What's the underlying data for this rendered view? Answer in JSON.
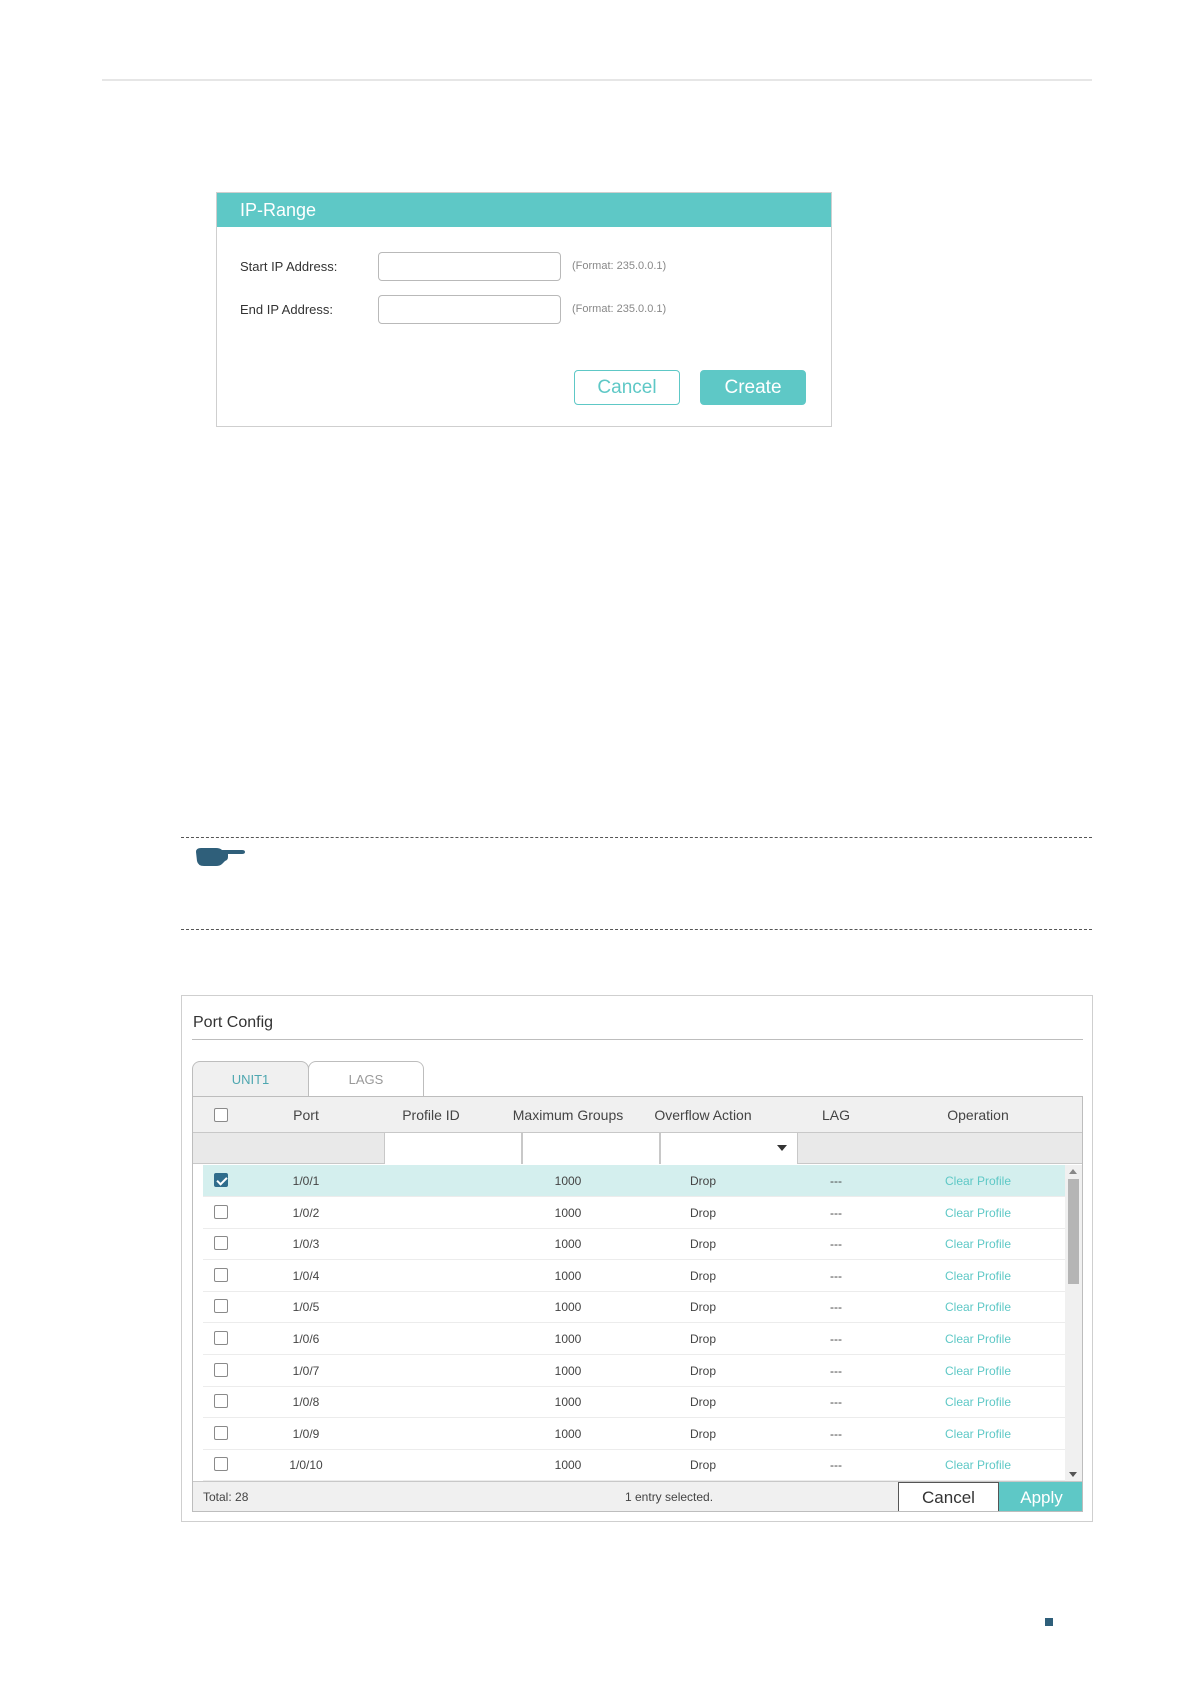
{
  "ip_range": {
    "title": "IP-Range",
    "start_label": "Start IP Address:",
    "start_value": "",
    "start_hint": "(Format: 235.0.0.1)",
    "end_label": "End IP Address:",
    "end_value": "",
    "end_hint": "(Format: 235.0.0.1)",
    "cancel_label": "Cancel",
    "create_label": "Create"
  },
  "port_config": {
    "title": "Port Config",
    "tabs": [
      {
        "label": "UNIT1",
        "active": true
      },
      {
        "label": "LAGS",
        "active": false
      }
    ],
    "columns": [
      "Port",
      "Profile ID",
      "Maximum Groups",
      "Overflow Action",
      "LAG",
      "Operation"
    ],
    "rows": [
      {
        "checked": true,
        "port": "1/0/1",
        "profile_id": "",
        "max_groups": "1000",
        "overflow": "Drop",
        "lag": "---",
        "op": "Clear Profile"
      },
      {
        "checked": false,
        "port": "1/0/2",
        "profile_id": "",
        "max_groups": "1000",
        "overflow": "Drop",
        "lag": "---",
        "op": "Clear Profile"
      },
      {
        "checked": false,
        "port": "1/0/3",
        "profile_id": "",
        "max_groups": "1000",
        "overflow": "Drop",
        "lag": "---",
        "op": "Clear Profile"
      },
      {
        "checked": false,
        "port": "1/0/4",
        "profile_id": "",
        "max_groups": "1000",
        "overflow": "Drop",
        "lag": "---",
        "op": "Clear Profile"
      },
      {
        "checked": false,
        "port": "1/0/5",
        "profile_id": "",
        "max_groups": "1000",
        "overflow": "Drop",
        "lag": "---",
        "op": "Clear Profile"
      },
      {
        "checked": false,
        "port": "1/0/6",
        "profile_id": "",
        "max_groups": "1000",
        "overflow": "Drop",
        "lag": "---",
        "op": "Clear Profile"
      },
      {
        "checked": false,
        "port": "1/0/7",
        "profile_id": "",
        "max_groups": "1000",
        "overflow": "Drop",
        "lag": "---",
        "op": "Clear Profile"
      },
      {
        "checked": false,
        "port": "1/0/8",
        "profile_id": "",
        "max_groups": "1000",
        "overflow": "Drop",
        "lag": "---",
        "op": "Clear Profile"
      },
      {
        "checked": false,
        "port": "1/0/9",
        "profile_id": "",
        "max_groups": "1000",
        "overflow": "Drop",
        "lag": "---",
        "op": "Clear Profile"
      },
      {
        "checked": false,
        "port": "1/0/10",
        "profile_id": "",
        "max_groups": "1000",
        "overflow": "Drop",
        "lag": "---",
        "op": "Clear Profile"
      }
    ],
    "footer": {
      "total": "Total: 28",
      "selected": "1 entry selected.",
      "cancel_label": "Cancel",
      "apply_label": "Apply"
    }
  },
  "icons": {
    "note": "pointing-hand-icon"
  },
  "colors": {
    "accent": "#5ec8c6",
    "selected_row": "#d4efee",
    "checkbox_checked": "#2f6d8c"
  }
}
